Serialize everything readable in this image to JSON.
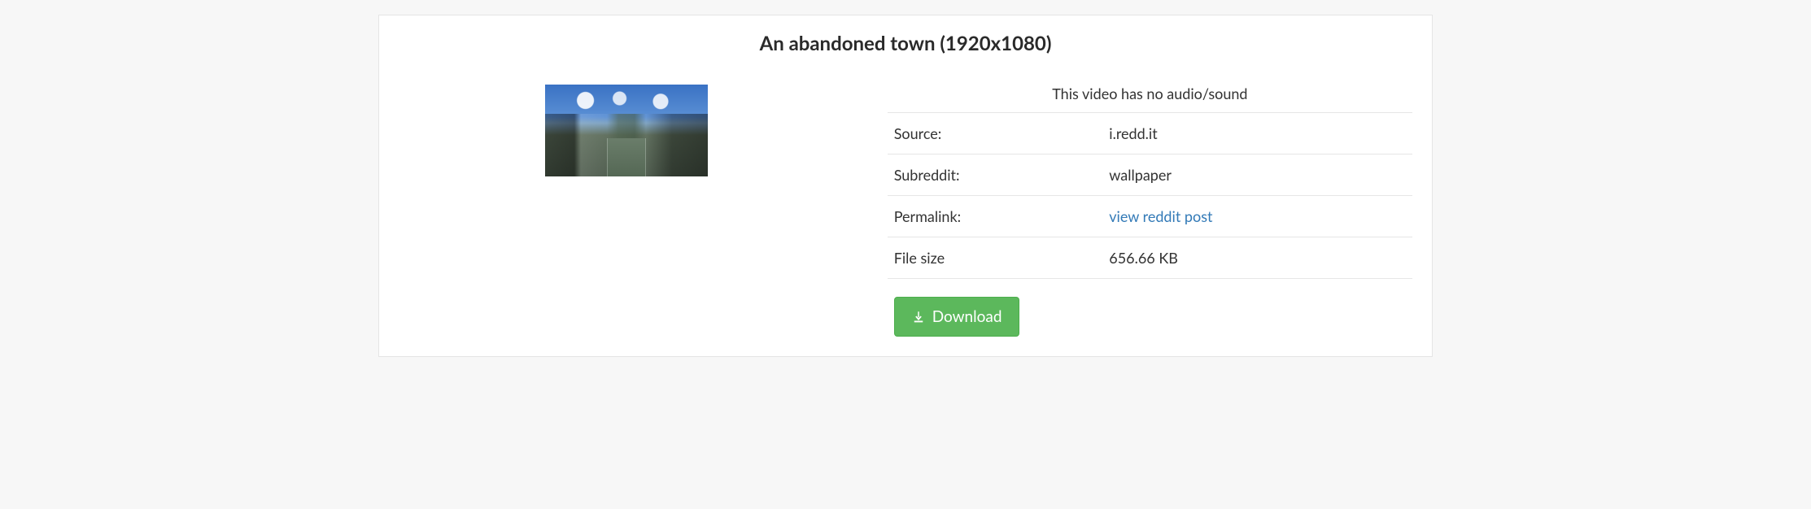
{
  "title": "An abandoned town (1920x1080)",
  "notice": "This video has no audio/sound",
  "rows": {
    "source": {
      "label": "Source:",
      "value": "i.redd.it"
    },
    "subreddit": {
      "label": "Subreddit:",
      "value": "wallpaper"
    },
    "permalink": {
      "label": "Permalink:",
      "link_text": "view reddit post"
    },
    "filesize": {
      "label": "File size",
      "value": "656.66 KB"
    }
  },
  "download_label": "Download"
}
